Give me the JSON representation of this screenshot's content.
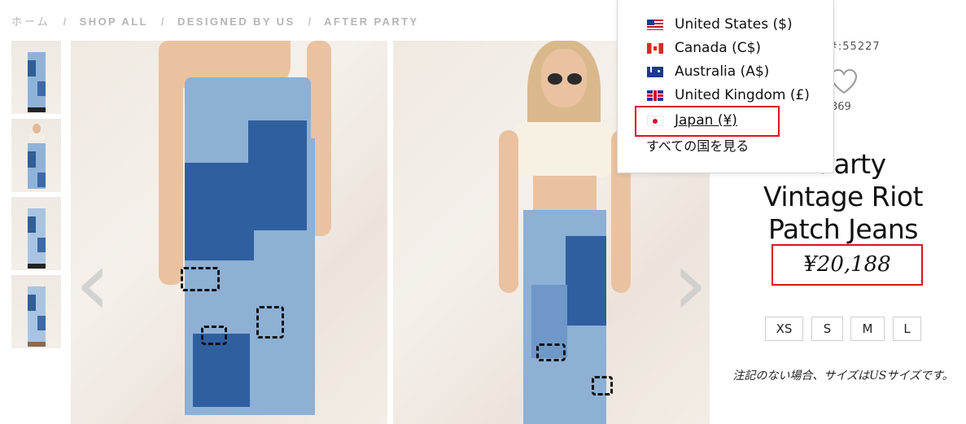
{
  "breadcrumb": {
    "home": "ホーム",
    "items": [
      "SHOP ALL",
      "DESIGNED BY US",
      "AFTER PARTY"
    ]
  },
  "product": {
    "sku": "#:55227",
    "likes": "369",
    "title_lines": [
      "r Party",
      "Vintage Riot",
      "Patch Jeans"
    ],
    "price": "¥20,188",
    "sizes": [
      "XS",
      "S",
      "M",
      "L"
    ],
    "size_note": "注記のない場合、サイズはUSサイズです。"
  },
  "country_menu": {
    "items": [
      {
        "label": "United States ($)",
        "flag": "us-flag-icon"
      },
      {
        "label": "Canada (C$)",
        "flag": "canada-flag-icon"
      },
      {
        "label": "Australia (A$)",
        "flag": "australia-flag-icon"
      },
      {
        "label": "United Kingdom (£)",
        "flag": "uk-flag-icon"
      },
      {
        "label": "Japan (¥)",
        "flag": "japan-flag-icon"
      }
    ],
    "view_all": "すべての国を見る"
  },
  "colors": {
    "highlight": "#d8151e",
    "breadcrumb": "#b5b5b5",
    "denim_dark": "#2f5f9f",
    "denim_light": "#8db0d4"
  }
}
